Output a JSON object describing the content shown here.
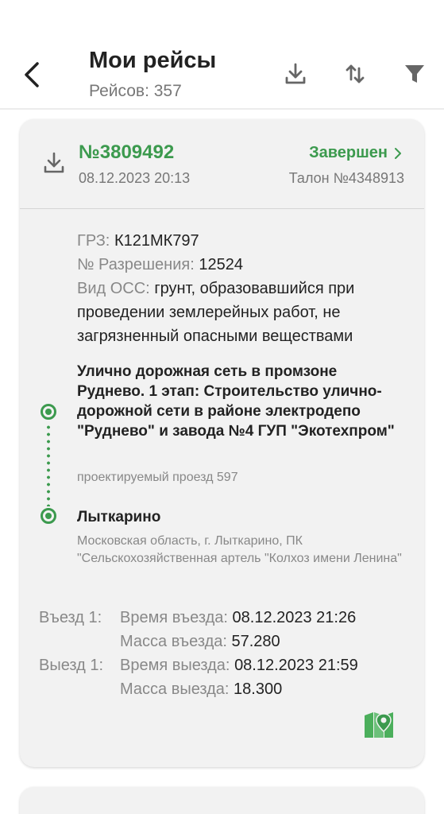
{
  "header": {
    "title": "Мои рейсы",
    "count_label": "Рейсов: 357",
    "icons": [
      "back-arrow-icon",
      "download-icon",
      "sort-icon",
      "filter-icon"
    ]
  },
  "colors": {
    "accent": "#3c9a4e",
    "muted": "#888888",
    "card_bg": "#f2f2f2"
  },
  "trip": {
    "number": "№3809492",
    "datetime": "08.12.2023 20:13",
    "status": "Завершен",
    "ticket": "Талон №4348913",
    "grz_label": "ГРЗ:",
    "grz_value": "К121МК797",
    "permit_label": "№ Разрешения:",
    "permit_value": "12524",
    "oss_label": "Вид ОСС:",
    "oss_value": "грунт, образовавшийся при проведении землерейных работ, не загрязненный опасными веществами",
    "from_title": "Улично дорожная сеть в промзоне Руднево. 1 этап: Строительство улично- дорожной сети в районе электродепо  \"Руднево\" и завода №4 ГУП \"Экотехпром\"",
    "from_sub": "проектируемый проезд 597",
    "to_title": "Лыткарино",
    "to_sub": "Московская область, г. Лыткарино, ПК \"Сельскохозяйственная артель \"Колхоз имени Ленина\"",
    "entry_label": "Въезд 1:",
    "entry_time_label": "Время въезда:",
    "entry_time_value": "08.12.2023 21:26",
    "entry_mass_label": "Масса въезда:",
    "entry_mass_value": "57.280",
    "exit_label": "Выезд 1:",
    "exit_time_label": "Время выезда:",
    "exit_time_value": "08.12.2023 21:59",
    "exit_mass_label": "Масса выезда:",
    "exit_mass_value": "18.300"
  }
}
